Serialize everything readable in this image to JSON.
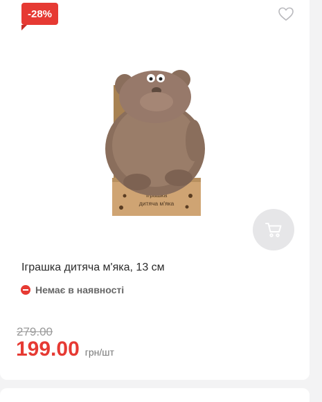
{
  "badge": {
    "discount": "-28%"
  },
  "product": {
    "title": "Іграшка дитяча м'яка, 13 см",
    "stock_status": "Немає в наявності",
    "old_price": "279.00",
    "price": "199.00",
    "unit": "грн/шт",
    "box_label": "Іграшка дитяча м'яка"
  },
  "icons": {
    "favorite": "heart-icon",
    "cart": "cart-icon",
    "stock": "minus-circle-icon"
  },
  "colors": {
    "accent": "#e63a33",
    "cart_button": "#e6e6e8"
  }
}
